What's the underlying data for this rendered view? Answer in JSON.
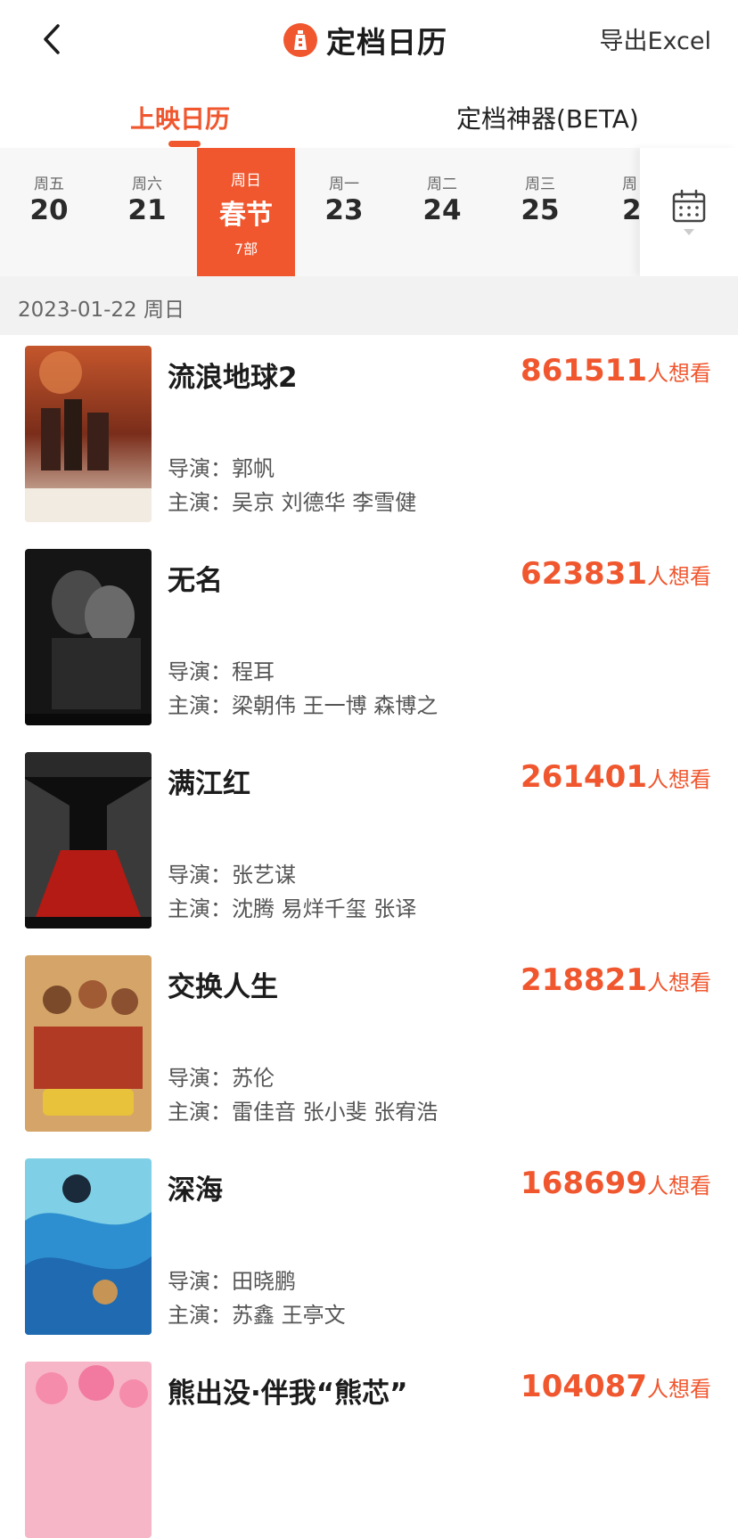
{
  "header": {
    "title": "定档日历",
    "export_label": "导出Excel"
  },
  "tabs": [
    {
      "label": "上映日历",
      "active": true
    },
    {
      "label": "定档神器(BETA)",
      "active": false
    }
  ],
  "days": [
    {
      "weekday": "周五",
      "date": "20"
    },
    {
      "weekday": "周六",
      "date": "21"
    },
    {
      "weekday": "周日",
      "date": "春节",
      "count": "7部",
      "active": true
    },
    {
      "weekday": "周一",
      "date": "23"
    },
    {
      "weekday": "周二",
      "date": "24"
    },
    {
      "weekday": "周三",
      "date": "25"
    },
    {
      "weekday": "周",
      "date": "2"
    }
  ],
  "date_header": "2023-01-22 周日",
  "unit_label": "人想看",
  "movies": [
    {
      "title": "流浪地球2",
      "score": "861511",
      "director": "导演：郭帆",
      "cast": "主演：吴京 刘德华 李雪健"
    },
    {
      "title": "无名",
      "score": "623831",
      "director": "导演：程耳",
      "cast": "主演：梁朝伟 王一博 森博之"
    },
    {
      "title": "满江红",
      "score": "261401",
      "director": "导演：张艺谋",
      "cast": "主演：沈腾 易烊千玺 张译"
    },
    {
      "title": "交换人生",
      "score": "218821",
      "director": "导演：苏伦",
      "cast": "主演：雷佳音 张小斐 张宥浩"
    },
    {
      "title": "深海",
      "score": "168699",
      "director": "导演：田晓鹏",
      "cast": "主演：苏鑫 王亭文"
    },
    {
      "title": "熊出没·伴我“熊芯”",
      "score": "104087",
      "director": "",
      "cast": ""
    }
  ],
  "colors": {
    "accent": "#f0572f",
    "text": "#1c1c1c",
    "muted": "#555555",
    "strip_bg": "#f7f7f7"
  }
}
